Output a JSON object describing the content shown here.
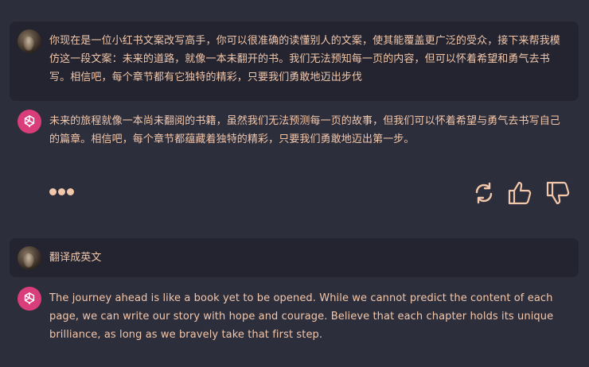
{
  "conversation": {
    "messages": [
      {
        "role": "user",
        "text": "你现在是一位小红书文案改写高手，你可以很准确的读懂别人的文案，使其能覆盖更广泛的受众，接下来帮我模仿这一段文案：未来的道路，就像一本未翻开的书。我们无法预知每一页的内容，但可以怀着希望和勇气去书写。相信吧，每个章节都有它独特的精彩，只要我们勇敢地迈出步伐"
      },
      {
        "role": "assistant",
        "text": "未来的旅程就像一本尚未翻阅的书籍，虽然我们无法预测每一页的故事，但我们可以怀着希望与勇气去书写自己的篇章。相信吧，每个章节都蕴藏着独特的精彩，只要我们勇敢地迈出第一步。"
      },
      {
        "role": "user",
        "text": "翻译成英文"
      },
      {
        "role": "assistant",
        "text": "The journey ahead is like a book yet to be opened. While we cannot predict the content of each page, we can write our story with hope and courage. Believe that each chapter holds its unique brilliance, as long as we bravely take that first step."
      }
    ]
  },
  "actions": {
    "icons": [
      "more-options-icon",
      "regenerate-icon",
      "thumbs-up-icon",
      "thumbs-down-icon"
    ]
  },
  "colors": {
    "background": "#2d2e3c",
    "user_bubble": "#232430",
    "text": "#f3c7aa",
    "bot_avatar": "#d93d7a"
  }
}
